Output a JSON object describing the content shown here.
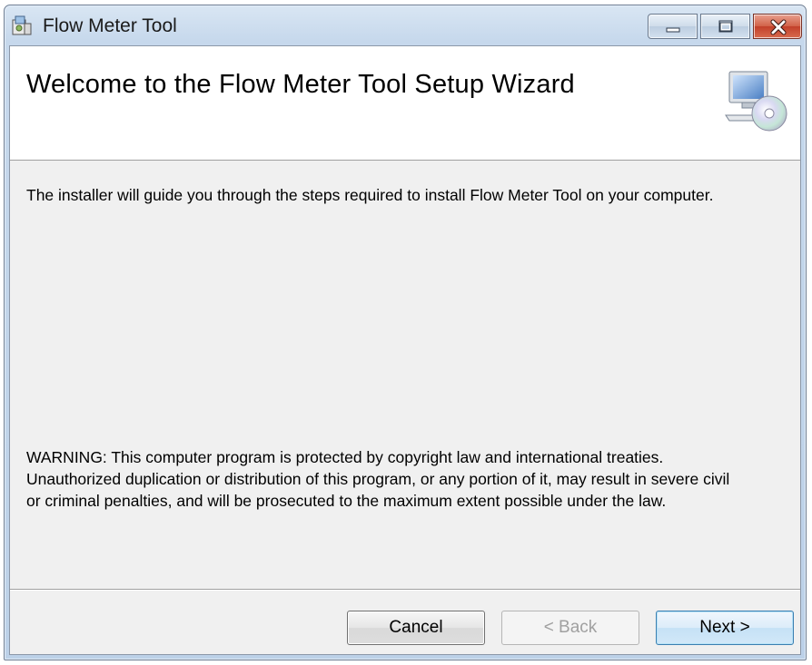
{
  "window": {
    "title": "Flow Meter Tool",
    "app_icon": "installer-icon",
    "caption_buttons": {
      "minimize_icon": "minimize-icon",
      "maximize_icon": "maximize-icon",
      "close_icon": "close-icon"
    }
  },
  "banner": {
    "title": "Welcome to the Flow Meter Tool Setup Wizard",
    "icon": "computer-cd-icon"
  },
  "body": {
    "intro": "The installer will guide you through the steps required to install Flow Meter Tool on your computer.",
    "warning": "WARNING: This computer program is protected by copyright law and international treaties.\nUnauthorized duplication or distribution of this program, or any portion of it, may result in severe civil\nor criminal penalties, and will be prosecuted to the maximum extent possible under the law."
  },
  "buttons": {
    "cancel": "Cancel",
    "back": "< Back",
    "next": "Next >"
  },
  "colors": {
    "dialog_background": "#f0f0f0",
    "banner_background": "#ffffff",
    "close_button": "#c2402a",
    "default_button_border": "#3c7fb1"
  }
}
